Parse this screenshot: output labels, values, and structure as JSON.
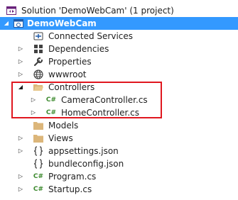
{
  "tree": {
    "solution": {
      "label": "Solution 'DemoWebCam' (1 project)",
      "icon": "solution-icon"
    },
    "project": {
      "label": "DemoWebCam",
      "icon": "web-project-icon",
      "selected": true
    },
    "items": [
      {
        "label": "Connected Services",
        "icon": "connected-services-icon"
      },
      {
        "label": "Dependencies",
        "icon": "dependencies-icon"
      },
      {
        "label": "Properties",
        "icon": "wrench-icon"
      },
      {
        "label": "wwwroot",
        "icon": "globe-icon"
      },
      {
        "label": "Controllers",
        "icon": "folder-open-icon"
      },
      {
        "label": "CameraController.cs",
        "icon": "csharp-file-icon"
      },
      {
        "label": "HomeController.cs",
        "icon": "csharp-file-icon"
      },
      {
        "label": "Models",
        "icon": "folder-icon"
      },
      {
        "label": "Views",
        "icon": "folder-icon"
      },
      {
        "label": "appsettings.json",
        "icon": "json-file-icon"
      },
      {
        "label": "bundleconfig.json",
        "icon": "json-file-icon"
      },
      {
        "label": "Program.cs",
        "icon": "csharp-file-icon"
      },
      {
        "label": "Startup.cs",
        "icon": "csharp-file-icon"
      }
    ],
    "csharp_glyph": "C#"
  },
  "colors": {
    "selection": "#3399ff",
    "highlight_border": "#e0171f",
    "folder": "#dcb67a",
    "csharp": "#3c8a2e"
  }
}
